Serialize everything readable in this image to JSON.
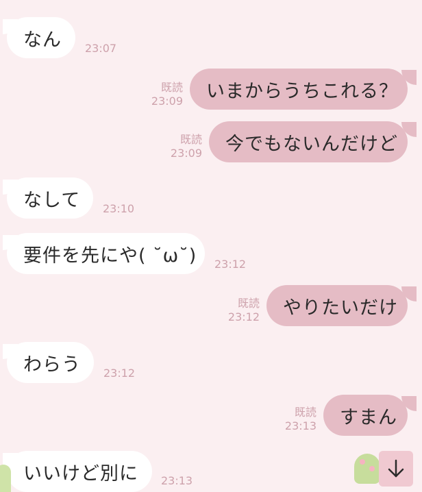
{
  "read_label": "既読",
  "messages": [
    {
      "side": "in",
      "text": "なん",
      "time": "23:07"
    },
    {
      "side": "out",
      "text": "いまからうちこれる？",
      "time": "23:09"
    },
    {
      "side": "out",
      "text": "今でもないんだけど",
      "time": "23:09"
    },
    {
      "side": "in",
      "text": "なして",
      "time": "23:10"
    },
    {
      "side": "in",
      "text": "要件を先にや( ˘ω˘)",
      "time": "23:12"
    },
    {
      "side": "out",
      "text": "やりたいだけ",
      "time": "23:12"
    },
    {
      "side": "in",
      "text": "わらう",
      "time": "23:12"
    },
    {
      "side": "out",
      "text": "すまん",
      "time": "23:13"
    },
    {
      "side": "in",
      "text": "いいけど別に",
      "time": "23:13"
    }
  ],
  "scroll_button": {
    "icon": "arrow-down-icon"
  },
  "colors": {
    "background": "#fbeff1",
    "incoming_bubble": "#ffffff",
    "outgoing_bubble": "#e5bcc5",
    "meta_text": "#cda1ab"
  }
}
